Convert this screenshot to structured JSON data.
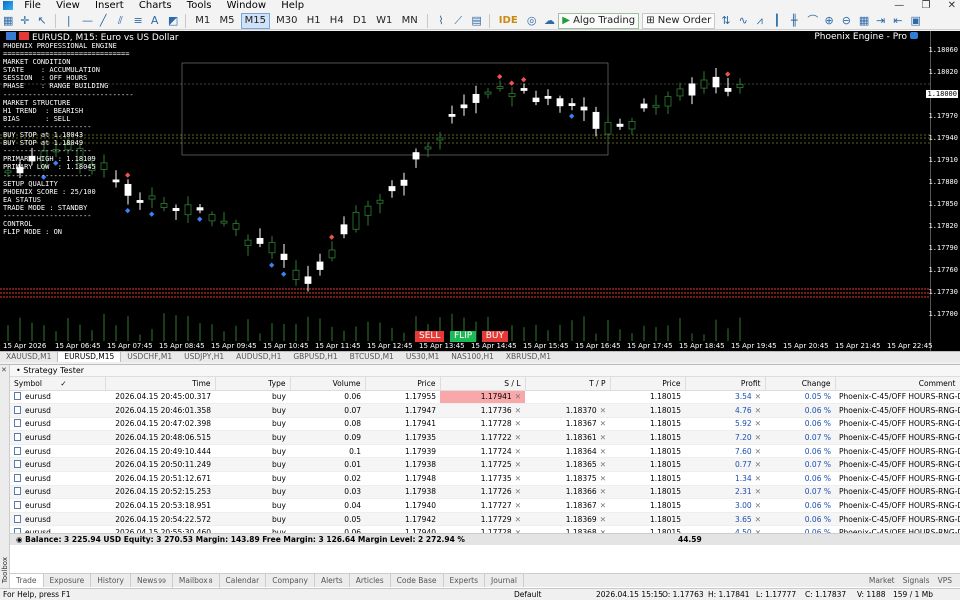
{
  "menu": [
    "File",
    "View",
    "Insert",
    "Charts",
    "Tools",
    "Window",
    "Help"
  ],
  "window_controls": [
    "—",
    "❐",
    "✕"
  ],
  "toolbar": {
    "timeframes": [
      "M1",
      "M5",
      "M15",
      "M30",
      "H1",
      "H4",
      "D1",
      "W1",
      "MN"
    ],
    "active_timeframe": "M15",
    "ide_label": "IDE",
    "algo_label": "Algo Trading",
    "new_order_label": "New Order"
  },
  "chart": {
    "title": "EURUSD, M15:  Euro vs US Dollar",
    "ea_name": "Phoenix Engine - Pro",
    "overlay_lines": [
      "PHOENIX PROFESSIONAL ENGINE",
      "==============================",
      "MARKET CONDITION",
      "STATE    : ACCUMULATION",
      "SESSION  : OFF HOURS",
      "PHASE    : RANGE BUILDING",
      "-------------------------------",
      "MARKET STRUCTURE",
      "H1 TREND  : BEARISH",
      "BIAS      : SELL",
      "---------------------",
      "BUY STOP at 1.18043",
      "BUY STOP at 1.18049",
      "---------------------",
      "PRIMARY HIGH : 1.18109",
      "PRIMARY LOW  : 1.18045",
      "---------------------",
      "SETUP QUALITY",
      "PHOENIX SCORE : 25/100",
      "EA STATUS",
      "TRADE MODE : STANDBY",
      "---------------------",
      "CONTROL",
      "FLIP MODE : ON"
    ],
    "price_labels": [
      "1.18060",
      "1.18020",
      "1.18000",
      "1.17970",
      "1.17940",
      "1.17910",
      "1.17880",
      "1.17850",
      "1.17820",
      "1.17790",
      "1.17760",
      "1.17730",
      "1.17700"
    ],
    "time_labels": [
      "15 Apr 2026",
      "15 Apr 06:45",
      "15 Apr 07:45",
      "15 Apr 08:45",
      "15 Apr 09:45",
      "15 Apr 10:45",
      "15 Apr 11:45",
      "15 Apr 12:45",
      "15 Apr 13:45",
      "15 Apr 14:45",
      "15 Apr 15:45",
      "15 Apr 16:45",
      "15 Apr 17:45",
      "15 Apr 18:45",
      "15 Apr 19:45",
      "15 Apr 20:45",
      "15 Apr 21:45",
      "15 Apr 22:45"
    ],
    "buttons": {
      "sell": "SELL",
      "flip": "FLIP",
      "buy": "BUY"
    },
    "colors": {
      "bull": "#ffffff",
      "bear": "#2e7d32",
      "support": "#e53935",
      "level": "#b8c93a",
      "arrow_up": "#3b82f6",
      "arrow_down": "#ef5350"
    }
  },
  "symbol_tabs": [
    "XAUUSD,M1",
    "EURUSD,M15",
    "USDCHF,M1",
    "USDJPY,H1",
    "AUDUSD,H1",
    "GBPUSD,H1",
    "BTCUSD,M1",
    "US30,M1",
    "NAS100,H1",
    "XBRUSD,M1"
  ],
  "active_symbol_tab": "EURUSD,M15",
  "strategy_tester_label": "Strategy Tester",
  "toolbox_label": "Toolbox",
  "table": {
    "headers": [
      "Symbol",
      "Time",
      "Type",
      "Volume",
      "Price",
      "S / L",
      "T / P",
      "Price",
      "Profit",
      "Change",
      "Comment"
    ],
    "rows": [
      {
        "symbol": "eurusd",
        "time": "2026.04.15 20:45:00.317",
        "type": "buy",
        "volume": "0.06",
        "price": "1.17955",
        "sl": "1.17941",
        "tp": "",
        "cur": "1.18015",
        "profit": "3.54",
        "change": "0.05 %",
        "comment": "Phoenix-C-45/OFF HOURS-RNG-DOWN"
      },
      {
        "symbol": "eurusd",
        "time": "2026.04.15 20:46:01.358",
        "type": "buy",
        "volume": "0.07",
        "price": "1.17947",
        "sl": "1.17736",
        "tp": "1.18370",
        "cur": "1.18015",
        "profit": "4.76",
        "change": "0.06 %",
        "comment": "Phoenix-C-45/OFF HOURS-RNG-DOWN"
      },
      {
        "symbol": "eurusd",
        "time": "2026.04.15 20:47:02.398",
        "type": "buy",
        "volume": "0.08",
        "price": "1.17941",
        "sl": "1.17728",
        "tp": "1.18367",
        "cur": "1.18015",
        "profit": "5.92",
        "change": "0.06 %",
        "comment": "Phoenix-C-45/OFF HOURS-RNG-DOWN"
      },
      {
        "symbol": "eurusd",
        "time": "2026.04.15 20:48:06.515",
        "type": "buy",
        "volume": "0.09",
        "price": "1.17935",
        "sl": "1.17722",
        "tp": "1.18361",
        "cur": "1.18015",
        "profit": "7.20",
        "change": "0.07 %",
        "comment": "Phoenix-C-45/OFF HOURS-RNG-DOWN"
      },
      {
        "symbol": "eurusd",
        "time": "2026.04.15 20:49:10.444",
        "type": "buy",
        "volume": "0.1",
        "price": "1.17939",
        "sl": "1.17724",
        "tp": "1.18364",
        "cur": "1.18015",
        "profit": "7.60",
        "change": "0.06 %",
        "comment": "Phoenix-C-45/OFF HOURS-RNG-DOWN"
      },
      {
        "symbol": "eurusd",
        "time": "2026.04.15 20:50:11.249",
        "type": "buy",
        "volume": "0.01",
        "price": "1.17938",
        "sl": "1.17725",
        "tp": "1.18365",
        "cur": "1.18015",
        "profit": "0.77",
        "change": "0.07 %",
        "comment": "Phoenix-C-45/OFF HOURS-RNG-DOWN"
      },
      {
        "symbol": "eurusd",
        "time": "2026.04.15 20:51:12.671",
        "type": "buy",
        "volume": "0.02",
        "price": "1.17948",
        "sl": "1.17735",
        "tp": "1.18375",
        "cur": "1.18015",
        "profit": "1.34",
        "change": "0.06 %",
        "comment": "Phoenix-C-45/OFF HOURS-RNG-DOWN"
      },
      {
        "symbol": "eurusd",
        "time": "2026.04.15 20:52:15.253",
        "type": "buy",
        "volume": "0.03",
        "price": "1.17938",
        "sl": "1.17726",
        "tp": "1.18366",
        "cur": "1.18015",
        "profit": "2.31",
        "change": "0.07 %",
        "comment": "Phoenix-C-45/OFF HOURS-RNG-DOWN"
      },
      {
        "symbol": "eurusd",
        "time": "2026.04.15 20:53:18.951",
        "type": "buy",
        "volume": "0.04",
        "price": "1.17940",
        "sl": "1.17727",
        "tp": "1.18367",
        "cur": "1.18015",
        "profit": "3.00",
        "change": "0.06 %",
        "comment": "Phoenix-C-45/OFF HOURS-RNG-DOWN"
      },
      {
        "symbol": "eurusd",
        "time": "2026.04.15 20:54:22.572",
        "type": "buy",
        "volume": "0.05",
        "price": "1.17942",
        "sl": "1.17729",
        "tp": "1.18369",
        "cur": "1.18015",
        "profit": "3.65",
        "change": "0.06 %",
        "comment": "Phoenix-C-45/OFF HOURS-RNG-DOWN"
      },
      {
        "symbol": "eurusd",
        "time": "2026.04.15 20:55:30.460",
        "type": "buy",
        "volume": "0.06",
        "price": "1.17940",
        "sl": "1.17728",
        "tp": "1.18368",
        "cur": "1.18015",
        "profit": "4.50",
        "change": "0.06 %",
        "comment": "Phoenix-C-45/OFF HOURS-RNG-DOWN"
      }
    ]
  },
  "balance_line": "Balance: 3 225.94 USD   Equity: 3 270.53   Margin: 143.89   Free Margin: 3 126.64   Margin Level: 2 272.94 %",
  "total_profit": "44.59",
  "bottom_tabs": [
    {
      "label": "Trade",
      "badge": ""
    },
    {
      "label": "Exposure",
      "badge": ""
    },
    {
      "label": "History",
      "badge": ""
    },
    {
      "label": "News",
      "badge": "99"
    },
    {
      "label": "Mailbox",
      "badge": "8"
    },
    {
      "label": "Calendar",
      "badge": ""
    },
    {
      "label": "Company",
      "badge": ""
    },
    {
      "label": "Alerts",
      "badge": ""
    },
    {
      "label": "Articles",
      "badge": ""
    },
    {
      "label": "Code Base",
      "badge": ""
    },
    {
      "label": "Experts",
      "badge": ""
    },
    {
      "label": "Journal",
      "badge": ""
    }
  ],
  "right_tools": [
    "Market",
    "Signals",
    "VPS"
  ],
  "status": {
    "help": "For Help, press F1",
    "profile": "Default",
    "datetime": "2026.04.15 15:15",
    "open": "O: 1.17763",
    "high": "H: 1.17841",
    "low": "L: 1.17777",
    "close": "C: 1.17837",
    "volume": "V: 1188",
    "traffic": "159 / 1 Mb"
  }
}
